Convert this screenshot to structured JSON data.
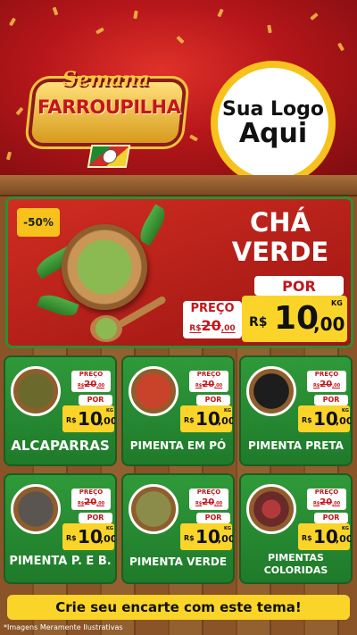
{
  "header": {
    "banner_top": "Semana",
    "banner_main": "FARROUPILHA",
    "logo_line1": "Sua Logo",
    "logo_line2": "Aqui"
  },
  "featured": {
    "discount": "-50%",
    "title_line1": "CHÁ",
    "title_line2": "VERDE",
    "preco_label": "PREÇO",
    "old_currency": "R$",
    "old_int": "20",
    "old_dec": ",00",
    "por_label": "POR",
    "currency": "R$",
    "price_int": "10",
    "price_dec": ",00",
    "unit": "KG"
  },
  "products": [
    {
      "name": "ALCAPARRAS",
      "preco_label": "PREÇO",
      "old_currency": "R$",
      "old_int": "20",
      "old_dec": ",00",
      "por_label": "POR",
      "currency": "R$",
      "price_int": "10",
      "price_dec": ",00",
      "unit": "KG"
    },
    {
      "name": "PIMENTA EM PÓ",
      "preco_label": "PREÇO",
      "old_currency": "R$",
      "old_int": "20",
      "old_dec": ",00",
      "por_label": "POR",
      "currency": "R$",
      "price_int": "10",
      "price_dec": ",00",
      "unit": "KG"
    },
    {
      "name": "PIMENTA PRETA",
      "preco_label": "PREÇO",
      "old_currency": "R$",
      "old_int": "20",
      "old_dec": ",00",
      "por_label": "POR",
      "currency": "R$",
      "price_int": "10",
      "price_dec": ",00",
      "unit": "KG"
    },
    {
      "name": "PIMENTA P. E B.",
      "preco_label": "PREÇO",
      "old_currency": "R$",
      "old_int": "20",
      "old_dec": ",00",
      "por_label": "POR",
      "currency": "R$",
      "price_int": "10",
      "price_dec": ",00",
      "unit": "KG"
    },
    {
      "name": "PIMENTA VERDE",
      "preco_label": "PREÇO",
      "old_currency": "R$",
      "old_int": "20",
      "old_dec": ",00",
      "por_label": "POR",
      "currency": "R$",
      "price_int": "10",
      "price_dec": ",00",
      "unit": "KG"
    },
    {
      "name_line1": "PIMENTAS",
      "name_line2": "COLORIDAS",
      "preco_label": "PREÇO",
      "old_currency": "R$",
      "old_int": "20",
      "old_dec": ",00",
      "por_label": "POR",
      "currency": "R$",
      "price_int": "10",
      "price_dec": ",00",
      "unit": "KG"
    }
  ],
  "footer": {
    "cta": "Crie seu encarte com este tema!",
    "disclaimer": "*Imagens Meramente Ilustrativas"
  },
  "colors": {
    "header_red": "#c4161c",
    "card_green": "#2f9a3a",
    "price_yellow": "#fbd42a",
    "wood_brown": "#8a5428"
  }
}
